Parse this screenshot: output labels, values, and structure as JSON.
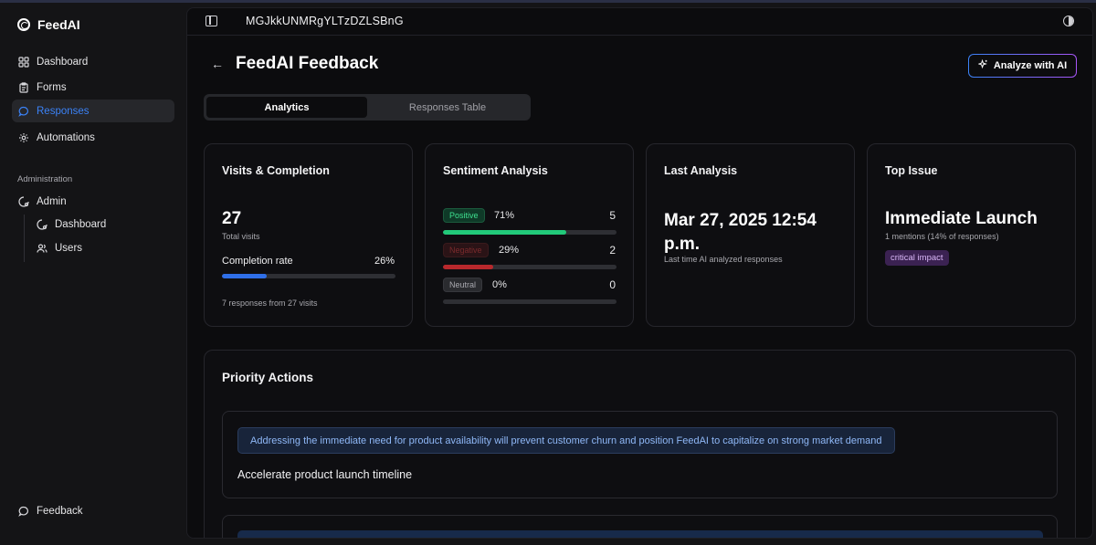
{
  "app": {
    "name": "FeedAI"
  },
  "sidebar": {
    "items": [
      {
        "label": "Dashboard",
        "icon": "grid-icon"
      },
      {
        "label": "Forms",
        "icon": "clipboard-icon"
      },
      {
        "label": "Responses",
        "icon": "chat-bubble-icon",
        "active": true
      },
      {
        "label": "Automations",
        "icon": "cog-icon"
      }
    ],
    "admin_section_label": "Administration",
    "admin": {
      "label": "Admin",
      "icon": "gear-shield-icon"
    },
    "admin_sub": [
      {
        "label": "Dashboard",
        "icon": "shield-cog-icon"
      },
      {
        "label": "Users",
        "icon": "users-icon"
      }
    ],
    "footer": {
      "label": "Feedback",
      "icon": "chat-bubble-icon"
    }
  },
  "header": {
    "doc_id": "MGJkkUNMRgYLTzDZLSBnG"
  },
  "page": {
    "title": "FeedAI Feedback",
    "analyze_label": "Analyze with AI",
    "tabs": [
      {
        "label": "Analytics",
        "active": true
      },
      {
        "label": "Responses Table",
        "active": false
      }
    ]
  },
  "cards": {
    "visits": {
      "title": "Visits & Completion",
      "total": "27",
      "total_label": "Total visits",
      "completion_label": "Completion rate",
      "completion_value": "26%",
      "completion_fraction": 0.26,
      "footnote": "7 responses from 27 visits"
    },
    "sentiment": {
      "title": "Sentiment Analysis",
      "rows": [
        {
          "label": "Positive",
          "pct": "71%",
          "count": "5",
          "fraction": 0.71,
          "color": "#22c97a"
        },
        {
          "label": "Negative",
          "pct": "29%",
          "count": "2",
          "fraction": 0.29,
          "color": "#b8282c"
        },
        {
          "label": "Neutral",
          "pct": "0%",
          "count": "0",
          "fraction": 0,
          "color": "#6b6b70"
        }
      ]
    },
    "last_analysis": {
      "title": "Last Analysis",
      "date": "Mar 27, 2025 12:54 p.m.",
      "subtitle": "Last time AI analyzed responses"
    },
    "top_issue": {
      "title": "Top Issue",
      "issue": "Immediate Launch",
      "mentions": "1 mentions (14% of responses)",
      "badge": "critical impact"
    }
  },
  "priority": {
    "title": "Priority Actions",
    "actions": [
      {
        "note": "Addressing the immediate need for product availability will prevent customer churn and position FeedAI to capitalize on strong market demand",
        "title": "Accelerate product launch timeline"
      }
    ]
  },
  "colors": {
    "accent": "#3b82f6",
    "completion_bar": "#2f6fe8",
    "gradient_start": "#3b82f6",
    "gradient_end": "#a855f7"
  }
}
